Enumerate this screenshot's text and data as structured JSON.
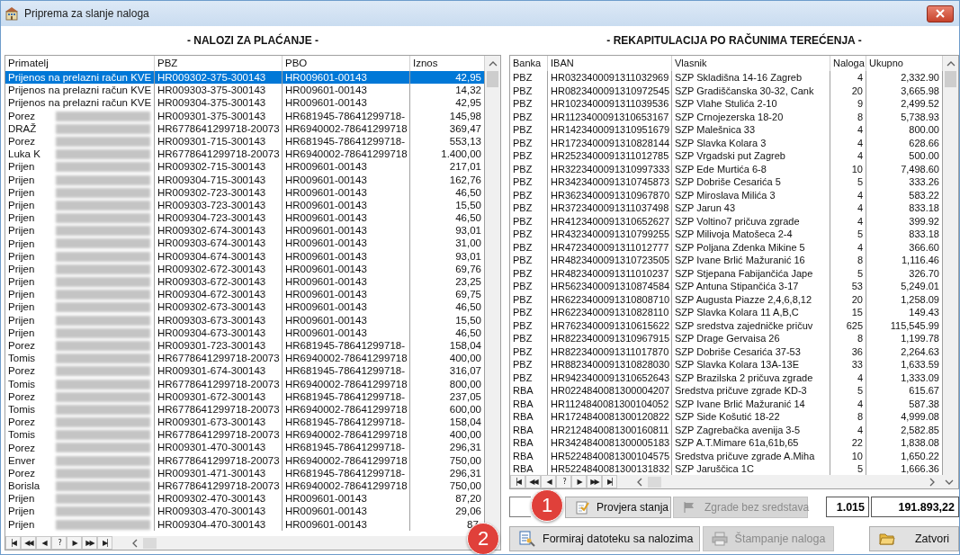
{
  "window": {
    "title": "Priprema za slanje naloga"
  },
  "left_panel": {
    "heading": "- NALOZI ZA PLAĆANJE -",
    "columns": [
      "Primatelj",
      "PBZ",
      "PBO",
      "Iznos"
    ],
    "rows": [
      {
        "primatelj": "Prijenos na prelazni račun KVE",
        "blurred": false,
        "pbz": "HR009302-375-300143",
        "pbo": "HR009601-00143",
        "iznos": "42,95",
        "selected": true
      },
      {
        "primatelj": "Prijenos na prelazni račun KVE",
        "blurred": false,
        "pbz": "HR009303-375-300143",
        "pbo": "HR009601-00143",
        "iznos": "14,32",
        "selected": false
      },
      {
        "primatelj": "Prijenos na prelazni račun KVE",
        "blurred": false,
        "pbz": "HR009304-375-300143",
        "pbo": "HR009601-00143",
        "iznos": "42,95",
        "selected": false
      },
      {
        "primatelj": "Porez",
        "blurred": true,
        "pbz": "HR009301-375-300143",
        "pbo": "HR681945-78641299718-",
        "iznos": "145,98",
        "selected": false
      },
      {
        "primatelj": "DRAŽ",
        "blurred": true,
        "pbz": "HR6778641299718-20073",
        "pbo": "HR6940002-78641299718",
        "iznos": "369,47",
        "selected": false
      },
      {
        "primatelj": "Porez",
        "blurred": true,
        "pbz": "HR009301-715-300143",
        "pbo": "HR681945-78641299718-",
        "iznos": "553,13",
        "selected": false
      },
      {
        "primatelj": "Luka K",
        "blurred": true,
        "pbz": "HR6778641299718-20073",
        "pbo": "HR6940002-78641299718",
        "iznos": "1.400,00",
        "selected": false
      },
      {
        "primatelj": "Prijen",
        "blurred": true,
        "pbz": "HR009302-715-300143",
        "pbo": "HR009601-00143",
        "iznos": "217,01",
        "selected": false
      },
      {
        "primatelj": "Prijen",
        "blurred": true,
        "pbz": "HR009304-715-300143",
        "pbo": "HR009601-00143",
        "iznos": "162,76",
        "selected": false
      },
      {
        "primatelj": "Prijen",
        "blurred": true,
        "pbz": "HR009302-723-300143",
        "pbo": "HR009601-00143",
        "iznos": "46,50",
        "selected": false
      },
      {
        "primatelj": "Prijen",
        "blurred": true,
        "pbz": "HR009303-723-300143",
        "pbo": "HR009601-00143",
        "iznos": "15,50",
        "selected": false
      },
      {
        "primatelj": "Prijen",
        "blurred": true,
        "pbz": "HR009304-723-300143",
        "pbo": "HR009601-00143",
        "iznos": "46,50",
        "selected": false
      },
      {
        "primatelj": "Prijen",
        "blurred": true,
        "pbz": "HR009302-674-300143",
        "pbo": "HR009601-00143",
        "iznos": "93,01",
        "selected": false
      },
      {
        "primatelj": "Prijen",
        "blurred": true,
        "pbz": "HR009303-674-300143",
        "pbo": "HR009601-00143",
        "iznos": "31,00",
        "selected": false
      },
      {
        "primatelj": "Prijen",
        "blurred": true,
        "pbz": "HR009304-674-300143",
        "pbo": "HR009601-00143",
        "iznos": "93,01",
        "selected": false
      },
      {
        "primatelj": "Prijen",
        "blurred": true,
        "pbz": "HR009302-672-300143",
        "pbo": "HR009601-00143",
        "iznos": "69,76",
        "selected": false
      },
      {
        "primatelj": "Prijen",
        "blurred": true,
        "pbz": "HR009303-672-300143",
        "pbo": "HR009601-00143",
        "iznos": "23,25",
        "selected": false
      },
      {
        "primatelj": "Prijen",
        "blurred": true,
        "pbz": "HR009304-672-300143",
        "pbo": "HR009601-00143",
        "iznos": "69,75",
        "selected": false
      },
      {
        "primatelj": "Prijen",
        "blurred": true,
        "pbz": "HR009302-673-300143",
        "pbo": "HR009601-00143",
        "iznos": "46,50",
        "selected": false
      },
      {
        "primatelj": "Prijen",
        "blurred": true,
        "pbz": "HR009303-673-300143",
        "pbo": "HR009601-00143",
        "iznos": "15,50",
        "selected": false
      },
      {
        "primatelj": "Prijen",
        "blurred": true,
        "pbz": "HR009304-673-300143",
        "pbo": "HR009601-00143",
        "iznos": "46,50",
        "selected": false
      },
      {
        "primatelj": "Porez",
        "blurred": true,
        "pbz": "HR009301-723-300143",
        "pbo": "HR681945-78641299718-",
        "iznos": "158,04",
        "selected": false
      },
      {
        "primatelj": "Tomis",
        "blurred": true,
        "pbz": "HR6778641299718-20073",
        "pbo": "HR6940002-78641299718",
        "iznos": "400,00",
        "selected": false
      },
      {
        "primatelj": "Porez",
        "blurred": true,
        "pbz": "HR009301-674-300143",
        "pbo": "HR681945-78641299718-",
        "iznos": "316,07",
        "selected": false
      },
      {
        "primatelj": "Tomis",
        "blurred": true,
        "pbz": "HR6778641299718-20073",
        "pbo": "HR6940002-78641299718",
        "iznos": "800,00",
        "selected": false
      },
      {
        "primatelj": "Porez",
        "blurred": true,
        "pbz": "HR009301-672-300143",
        "pbo": "HR681945-78641299718-",
        "iznos": "237,05",
        "selected": false
      },
      {
        "primatelj": "Tomis",
        "blurred": true,
        "pbz": "HR6778641299718-20073",
        "pbo": "HR6940002-78641299718",
        "iznos": "600,00",
        "selected": false
      },
      {
        "primatelj": "Porez",
        "blurred": true,
        "pbz": "HR009301-673-300143",
        "pbo": "HR681945-78641299718-",
        "iznos": "158,04",
        "selected": false
      },
      {
        "primatelj": "Tomis",
        "blurred": true,
        "pbz": "HR6778641299718-20073",
        "pbo": "HR6940002-78641299718",
        "iznos": "400,00",
        "selected": false
      },
      {
        "primatelj": "Porez",
        "blurred": true,
        "pbz": "HR009301-470-300143",
        "pbo": "HR681945-78641299718-",
        "iznos": "296,31",
        "selected": false
      },
      {
        "primatelj": "Enver",
        "blurred": true,
        "pbz": "HR6778641299718-20073",
        "pbo": "HR6940002-78641299718",
        "iznos": "750,00",
        "selected": false
      },
      {
        "primatelj": "Porez",
        "blurred": true,
        "pbz": "HR009301-471-300143",
        "pbo": "HR681945-78641299718-",
        "iznos": "296,31",
        "selected": false
      },
      {
        "primatelj": "Borisla",
        "blurred": true,
        "pbz": "HR6778641299718-20073",
        "pbo": "HR6940002-78641299718",
        "iznos": "750,00",
        "selected": false
      },
      {
        "primatelj": "Prijen",
        "blurred": true,
        "pbz": "HR009302-470-300143",
        "pbo": "HR009601-00143",
        "iznos": "87,20",
        "selected": false
      },
      {
        "primatelj": "Prijen",
        "blurred": true,
        "pbz": "HR009303-470-300143",
        "pbo": "HR009601-00143",
        "iznos": "29,06",
        "selected": false
      },
      {
        "primatelj": "Prijen",
        "blurred": true,
        "pbz": "HR009304-470-300143",
        "pbo": "HR009601-00143",
        "iznos": "87,",
        "selected": false
      }
    ],
    "navigator": [
      "|◀",
      "◀◀",
      "◀",
      "?",
      "▶",
      "▶▶",
      "▶|"
    ]
  },
  "right_panel": {
    "heading": "- REKAPITULACIJA PO RAČUNIMA TEREĆENJA -",
    "columns": [
      "Banka",
      "IBAN",
      "Vlasnik",
      "Naloga",
      "Ukupno"
    ],
    "rows": [
      [
        "PBZ",
        "HR0323400091311032969",
        "SZP Skladišna 14-16 Zagreb",
        "4",
        "2,332.90"
      ],
      [
        "PBZ",
        "HR0823400091310972545",
        "SZP Gradiščanska 30-32, Cank",
        "20",
        "3,665.98"
      ],
      [
        "PBZ",
        "HR1023400091311039536",
        "SZP Vlahe Stulića 2-10",
        "9",
        "2,499.52"
      ],
      [
        "PBZ",
        "HR1123400091310653167",
        "SZP Crnojezerska 18-20",
        "8",
        "5,738.93"
      ],
      [
        "PBZ",
        "HR1423400091310951679",
        "SZP Malešnica 33",
        "4",
        "800.00"
      ],
      [
        "PBZ",
        "HR1723400091310828144",
        "SZP Slavka Kolara 3",
        "4",
        "628.66"
      ],
      [
        "PBZ",
        "HR2523400091311012785",
        "SZP Vrgadski put Zagreb",
        "4",
        "500.00"
      ],
      [
        "PBZ",
        "HR3223400091310997333",
        "SZP Ede Murtića 6-8",
        "10",
        "7,498.60"
      ],
      [
        "PBZ",
        "HR3423400091310745873",
        "SZP Dobriše Cesarića 5",
        "5",
        "333.26"
      ],
      [
        "PBZ",
        "HR3623400091310967870",
        "SZP Miroslava Milića 3",
        "4",
        "583.22"
      ],
      [
        "PBZ",
        "HR3723400091311037498",
        "SZP Jarun 43",
        "4",
        "833.18"
      ],
      [
        "PBZ",
        "HR4123400091310652627",
        "SZP Voltino7 pričuva zgrade",
        "4",
        "399.92"
      ],
      [
        "PBZ",
        "HR4323400091310799255",
        "SZP Milivoja Matošeca 2-4",
        "5",
        "833.18"
      ],
      [
        "PBZ",
        "HR4723400091311012777",
        "SZP Poljana Zdenka Mikine 5",
        "4",
        "366.60"
      ],
      [
        "PBZ",
        "HR4823400091310723505",
        "SZP Ivane Brlić Mažuranić 16",
        "8",
        "1,116.46"
      ],
      [
        "PBZ",
        "HR4823400091311010237",
        "SZP Stjepana Fabijančića Jape",
        "5",
        "326.70"
      ],
      [
        "PBZ",
        "HR5623400091310874584",
        "SZP Antuna Stipančića 3-17",
        "53",
        "5,249.01"
      ],
      [
        "PBZ",
        "HR6223400091310808710",
        "SZP Augusta Piazze 2,4,6,8,12",
        "20",
        "1,258.09"
      ],
      [
        "PBZ",
        "HR6223400091310828110",
        "SZP Slavka Kolara 11 A,B,C",
        "15",
        "149.43"
      ],
      [
        "PBZ",
        "HR7623400091310615622",
        "SZP sredstva zajedničke pričuv",
        "625",
        "115,545.99"
      ],
      [
        "PBZ",
        "HR8223400091310967915",
        "SZP Drage Gervaisa 26",
        "8",
        "1,199.78"
      ],
      [
        "PBZ",
        "HR8223400091311017870",
        "SZP Dobriše Cesarića 37-53",
        "36",
        "2,264.63"
      ],
      [
        "PBZ",
        "HR8823400091310828030",
        "SZP Slavka Kolara 13A-13E",
        "33",
        "1,633.59"
      ],
      [
        "PBZ",
        "HR9423400091310652643",
        "SZP Brazilska 2 pričuva zgrade",
        "4",
        "1,333.09"
      ],
      [
        "RBA",
        "HR0224840081300004207",
        "Sredstva  pričuve zgrade KD-3",
        "5",
        "615.67"
      ],
      [
        "RBA",
        "HR1124840081300104052",
        "SZP Ivane Brlić Mažuranić 14",
        "4",
        "587.38"
      ],
      [
        "RBA",
        "HR1724840081300120822",
        "SZP Side Košutić 18-22",
        "8",
        "4,999.08"
      ],
      [
        "RBA",
        "HR2124840081300160811",
        "SZP Zagrebačka  avenija 3-5",
        "4",
        "2,582.85"
      ],
      [
        "RBA",
        "HR3424840081300005183",
        "SZP A.T.Mimare 61a,61b,65",
        "22",
        "1,838.08"
      ],
      [
        "RBA",
        "HR5224840081300104575",
        "Sredstva pričuve zgrade A.Miha",
        "10",
        "1,650.22"
      ],
      [
        "RBA",
        "HR5224840081300131832",
        "SZP Jaruščica 1C",
        "5",
        "1,666.36"
      ]
    ],
    "navigator": [
      "|◀",
      "◀◀",
      "◀",
      "?",
      "▶",
      "▶▶",
      "▶|"
    ],
    "check_buttons": [
      {
        "label": "Provjera stanja",
        "disabled": false
      },
      {
        "label": "Zgrade bez sredstava",
        "disabled": true
      }
    ],
    "totals": {
      "count": "1.015",
      "sum": "191.893,22"
    }
  },
  "actions": [
    {
      "label": "Formiraj datoteku sa nalozima",
      "disabled": false
    },
    {
      "label": "Štampanje naloga",
      "disabled": true
    },
    {
      "label": "Zatvori",
      "disabled": false
    }
  ],
  "callouts": [
    "1",
    "2"
  ]
}
